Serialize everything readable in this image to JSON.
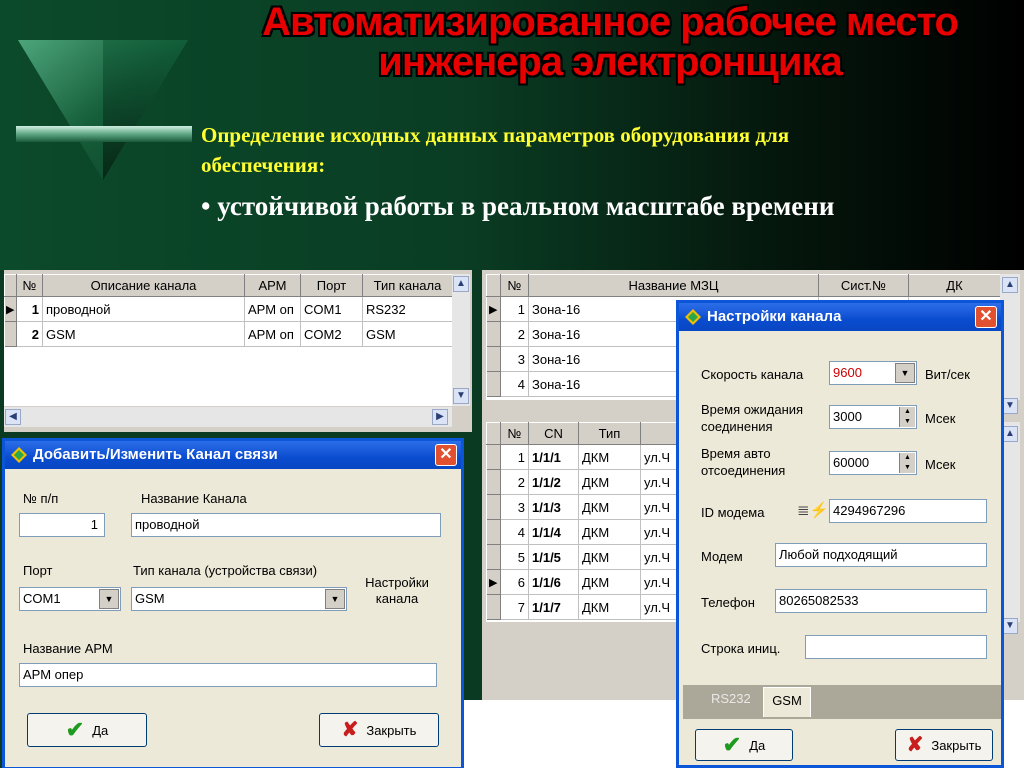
{
  "slide": {
    "title_line1": "Автоматизированное рабочее место",
    "title_line2": "инженера электронщика",
    "subtitle_line1": "Определение исходных данных  параметров оборудования для",
    "subtitle_line2": "обеспечения:",
    "bullet": "• устойчивой работы в реальном масштабе времени"
  },
  "channels_grid": {
    "headers": [
      "№",
      "Описание канала",
      "АРМ",
      "Порт",
      "Тип канала"
    ],
    "rows": [
      {
        "n": "1",
        "desc": "проводной",
        "arm": "АРМ оп",
        "port": "COM1",
        "type": "RS232"
      },
      {
        "n": "2",
        "desc": "GSM",
        "arm": "АРМ оп",
        "port": "COM2",
        "type": "GSM"
      }
    ]
  },
  "zones_grid": {
    "headers": [
      "№",
      "Название МЗЦ",
      "Сист.№",
      "ДК"
    ],
    "rows": [
      {
        "n": "1",
        "name": "Зона-16"
      },
      {
        "n": "2",
        "name": "Зона-16"
      },
      {
        "n": "3",
        "name": "Зона-16"
      },
      {
        "n": "4",
        "name": "Зона-16"
      }
    ]
  },
  "devices_grid": {
    "headers": [
      "№",
      "CN",
      "Тип",
      ""
    ],
    "rows": [
      {
        "n": "1",
        "cn": "1/1/1",
        "type": "ДКМ",
        "addr": "ул.Ч"
      },
      {
        "n": "2",
        "cn": "1/1/2",
        "type": "ДКМ",
        "addr": "ул.Ч"
      },
      {
        "n": "3",
        "cn": "1/1/3",
        "type": "ДКМ",
        "addr": "ул.Ч"
      },
      {
        "n": "4",
        "cn": "1/1/4",
        "type": "ДКМ",
        "addr": "ул.Ч"
      },
      {
        "n": "5",
        "cn": "1/1/5",
        "type": "ДКМ",
        "addr": "ул.Ч"
      },
      {
        "n": "6",
        "cn": "1/1/6",
        "type": "ДКМ",
        "addr": "ул.Ч"
      },
      {
        "n": "7",
        "cn": "1/1/7",
        "type": "ДКМ",
        "addr": "ул.Ч"
      }
    ]
  },
  "edit_dialog": {
    "title": "Добавить/Изменить Канал связи",
    "num_label": "№ п/п",
    "num_value": "1",
    "name_label": "Название Канала",
    "name_value": "проводной",
    "port_label": "Порт",
    "port_value": "COM1",
    "type_label": "Тип  канала (устройства связи)",
    "type_value": "GSM",
    "settings_label_1": "Настройки",
    "settings_label_2": "канала",
    "arm_label": "Название АРМ",
    "arm_value": "АРМ опер",
    "ok_label": "Да",
    "close_label": "Закрыть"
  },
  "settings_dialog": {
    "title": "Настройки канала",
    "speed_label": "Скорость канала",
    "speed_value": "9600",
    "speed_unit": "Вит/сек",
    "wait_label_1": "Время ожидания",
    "wait_label_2": "соединения",
    "wait_value": "3000",
    "wait_unit": "Мсек",
    "auto_label_1": "Время авто",
    "auto_label_2": "отсоединения",
    "auto_value": "60000",
    "auto_unit": "Мсек",
    "modem_id_label": "ID модема",
    "modem_id_value": "4294967296",
    "modem_label": "Модем",
    "modem_value": "Любой подходящий",
    "phone_label": "Телефон",
    "phone_value": "80265082533",
    "init_label": "Строка иниц.",
    "init_value": "",
    "tabs": [
      "RS232",
      "GSM"
    ],
    "ok_label": "Да",
    "close_label": "Закрыть"
  },
  "colors": {
    "title_red": "#e60000",
    "subtitle_yellow": "#ffff33",
    "dialog_blue": "#0a55d8",
    "speed_value_red": "#cc0000"
  }
}
